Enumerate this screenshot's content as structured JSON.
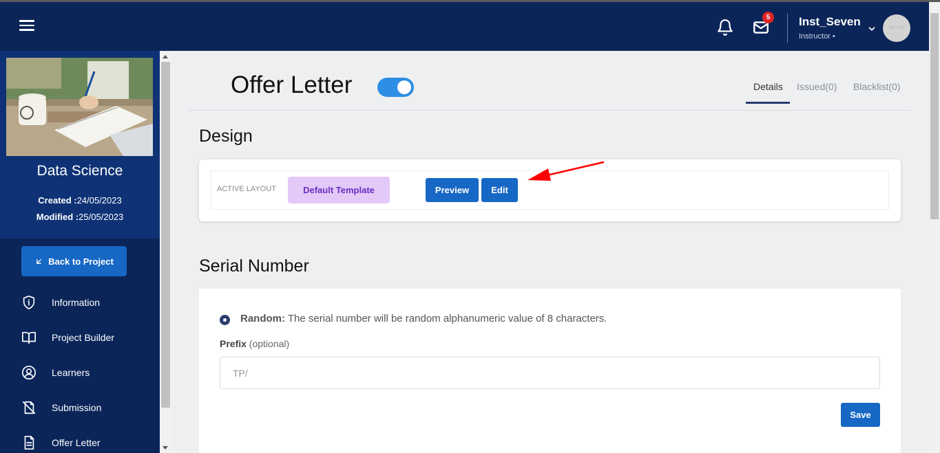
{
  "header": {
    "notification_count": "5",
    "user_name": "Inst_Seven",
    "user_role": "Instructor •",
    "avatar_text": "50 x 50"
  },
  "sidebar": {
    "project_title": "Data Science",
    "created_label": "Created :",
    "created_value": "24/05/2023",
    "modified_label": "Modified :",
    "modified_value": "25/05/2023",
    "back_label": "Back to Project",
    "items": [
      {
        "label": "Information",
        "icon": "shield-icon"
      },
      {
        "label": "Project Builder",
        "icon": "book-icon"
      },
      {
        "label": "Learners",
        "icon": "user-circle-icon"
      },
      {
        "label": "Submission",
        "icon": "submission-icon"
      },
      {
        "label": "Offer Letter",
        "icon": "document-icon"
      }
    ]
  },
  "main": {
    "page_title": "Offer Letter",
    "tabs": [
      {
        "label": "Details"
      },
      {
        "label": "Issued(0)"
      },
      {
        "label": "Blacklist(0)"
      }
    ],
    "design": {
      "heading": "Design",
      "active_layout_label": "ACTIVE LAYOUT",
      "template_label": "Default Template",
      "preview_label": "Preview",
      "edit_label": "Edit"
    },
    "serial": {
      "heading": "Serial Number",
      "random_label": "Random:",
      "random_desc": " The serial number will be random alphanumeric value of 8 characters.",
      "prefix_label": "Prefix",
      "prefix_optional": " (optional)",
      "prefix_placeholder": "TP/",
      "save_label": "Save"
    }
  },
  "colors": {
    "header_bg": "#0b2559",
    "sidebar_top_bg": "#0e3275",
    "primary_button": "#1767c4",
    "template_button_bg": "#e3c9f8",
    "template_button_text": "#6b2fc2",
    "toggle_on": "#2d8ee6",
    "badge": "#e02424",
    "annotation_arrow": "#ff0000"
  }
}
